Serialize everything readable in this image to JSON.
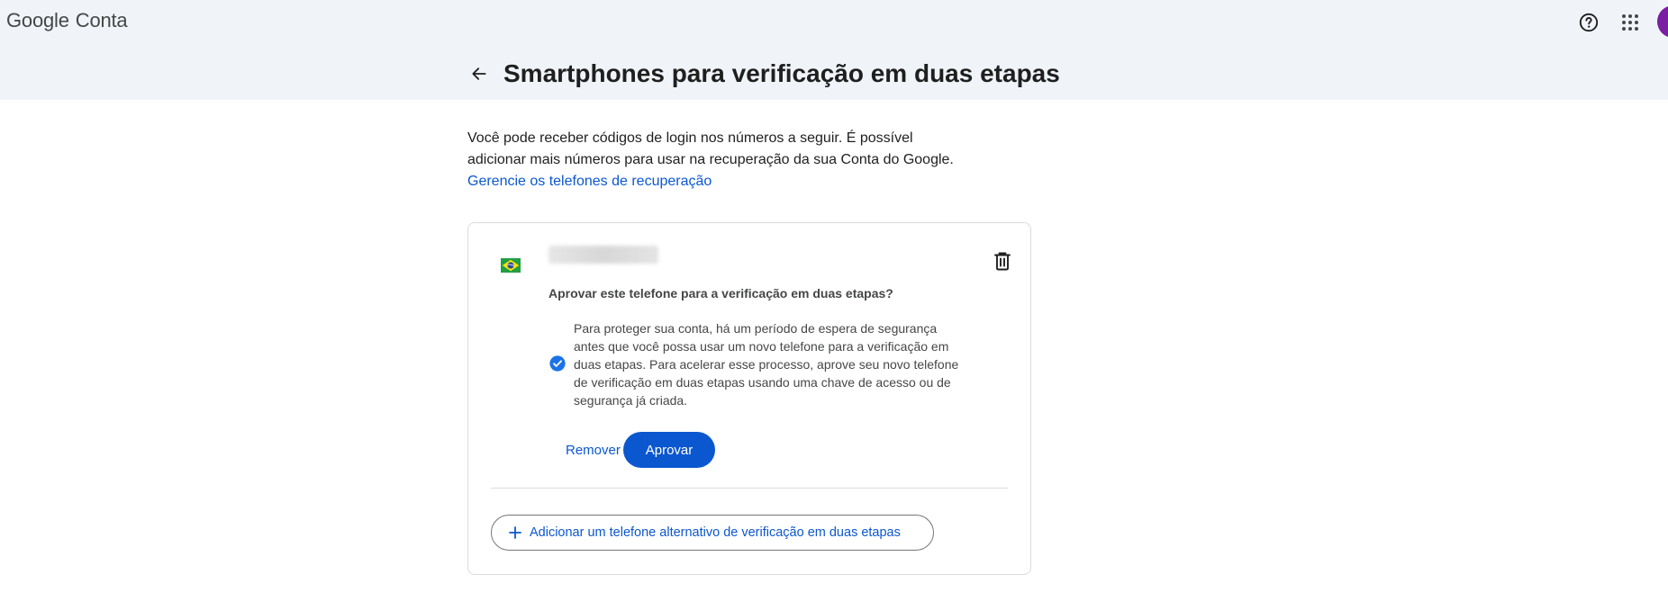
{
  "header": {
    "brand_google": "Google",
    "brand_product": "Conta",
    "help_icon": "help-circle-icon",
    "apps_icon": "apps-grid-icon"
  },
  "page": {
    "back_icon": "arrow-left-icon",
    "title": "Smartphones para verificação em duas etapas"
  },
  "intro": {
    "text": "Você pode receber códigos de login nos números a seguir. É possível adicionar mais números para usar na recuperação da sua Conta do Google.",
    "link": "Gerencie os telefones de recuperação"
  },
  "card": {
    "flag_icon": "brazil-flag-icon",
    "phone_number": "",
    "delete_icon": "trash-icon",
    "question": "Aprovar este telefone para a verificação em duas etapas?",
    "check_icon": "verified-check-icon",
    "notice": "Para proteger sua conta, há um período de espera de segurança antes que você possa usar um novo telefone para a verificação em duas etapas. Para acelerar esse processo, aprove seu novo telefone de verificação em duas etapas usando uma chave de acesso ou de segurança já criada.",
    "remove_label": "Remover",
    "approve_label": "Aprovar",
    "add_alt_label": "Adicionar um telefone alternativo de verificação em duas etapas"
  },
  "colors": {
    "header_bg": "#f0f4f9",
    "primary": "#0b57d0",
    "text": "#1f1f1f",
    "secondary_text": "#444746",
    "avatar": "#7b1fa2"
  }
}
